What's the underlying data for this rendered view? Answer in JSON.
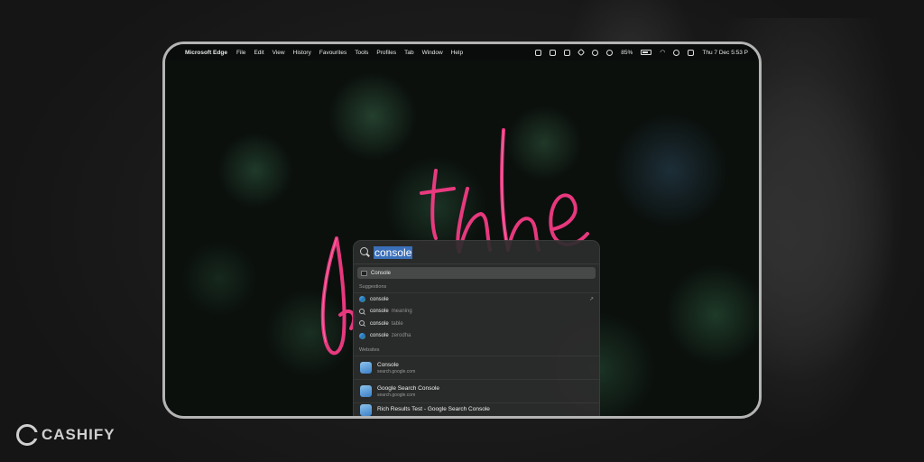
{
  "menubar": {
    "apple": "",
    "app_name": "Microsoft Edge",
    "items": [
      "File",
      "Edit",
      "View",
      "History",
      "Favourites",
      "Tools",
      "Profiles",
      "Tab",
      "Window",
      "Help"
    ],
    "battery": "85%",
    "datetime": "Thu 7 Dec  5:53 P"
  },
  "spotlight": {
    "query": "console",
    "top_hit": "Console",
    "suggestions_heading": "Suggestions",
    "suggestions": [
      {
        "term": "console",
        "hint": "",
        "icon": "edge-icon",
        "arrow": "↗"
      },
      {
        "term": "console",
        "hint": "meaning",
        "icon": "search-icon",
        "arrow": ""
      },
      {
        "term": "console",
        "hint": "table",
        "icon": "search-icon",
        "arrow": ""
      },
      {
        "term": "console",
        "hint": "zerodha",
        "icon": "edge-icon",
        "arrow": ""
      }
    ],
    "websites_heading": "Websites",
    "websites": [
      {
        "title": "Console",
        "url": "search.google.com"
      },
      {
        "title": "Google Search Console",
        "url": "search.google.com"
      },
      {
        "title": "Rich Results Test - Google Search Console",
        "url": ""
      }
    ]
  },
  "watermark": {
    "text": "CASHIFY"
  },
  "colors": {
    "neon": "#ff3d8a",
    "selection": "#3b6fb8",
    "frame": "#b4b4b4"
  }
}
